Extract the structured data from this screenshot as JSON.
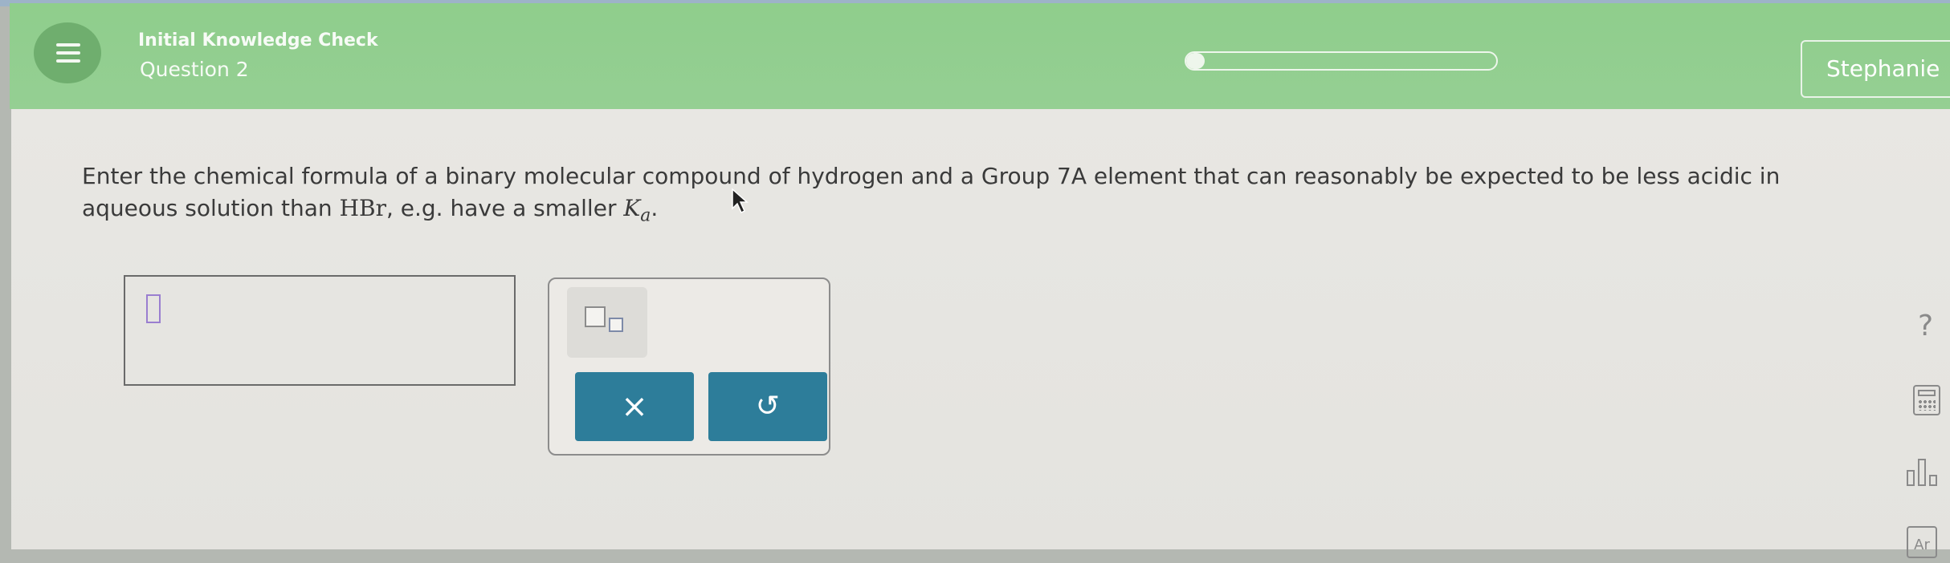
{
  "header": {
    "menu_icon": "hamburger-menu-icon",
    "subtitle": "Initial Knowledge Check",
    "title": "Question 2",
    "progress_fraction": 0.06,
    "user_name": "Stephanie"
  },
  "question": {
    "part1": "Enter the chemical formula of a binary molecular compound of hydrogen and a Group 7A element that can reasonably be expected to be less acidic in aqueous solution than ",
    "formula": "HBr",
    "part2": ", e.g. have a smaller ",
    "k_symbol": "K",
    "k_subscript": "a",
    "end": "."
  },
  "tools": {
    "subscript_icon": "subscript-template-icon",
    "clear_label": "×",
    "undo_label": "↺"
  },
  "side": {
    "help_label": "?",
    "periodic_label": "Ar"
  },
  "colors": {
    "header_green": "#8fce8c",
    "button_teal": "#2d7d9a"
  }
}
